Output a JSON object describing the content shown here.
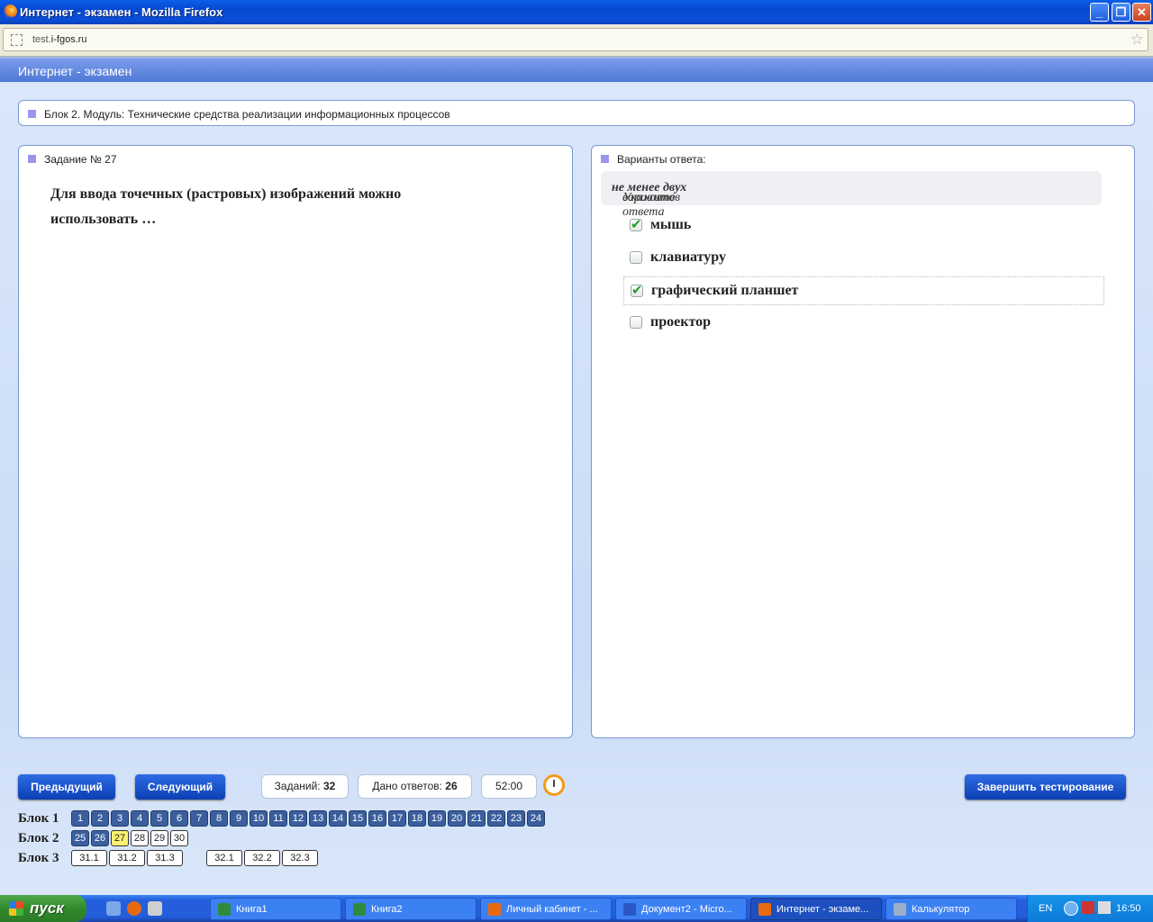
{
  "window": {
    "title": "Интернет - экзамен - Mozilla Firefox",
    "min": "_",
    "max": "❐",
    "close": "✕"
  },
  "address": {
    "url_prefix": "test.",
    "url_domain": "i-fgos.ru",
    "star": "☆"
  },
  "header": {
    "title": "Интернет - экзамен"
  },
  "block_info": {
    "text": "Блок 2. Модуль: Технические средства реализации информационных процессов"
  },
  "task": {
    "label": "Задание № 27",
    "question_line1": "Для ввода точечных (растровых) изображений можно",
    "question_line2": "использовать …"
  },
  "answers": {
    "label": "Варианты ответа:",
    "hint_pre": "Укажите ",
    "hint_bold": "не менее двух",
    "hint_post": " вариантов ответа",
    "options": [
      {
        "label": "мышь",
        "checked": true
      },
      {
        "label": "клавиатуру",
        "checked": false
      },
      {
        "label": "графический планшет",
        "checked": true
      },
      {
        "label": "проектор",
        "checked": false
      }
    ]
  },
  "nav": {
    "prev": "Предыдущий",
    "next": "Следующий",
    "tasks_label": "Заданий: ",
    "tasks_count": "32",
    "answered_label": "Дано ответов: ",
    "answered_count": "26",
    "timer": "52:00",
    "finish": "Завершить тестирование"
  },
  "blocks": [
    {
      "label": "Блок 1",
      "items": [
        {
          "n": "1",
          "s": "answered"
        },
        {
          "n": "2",
          "s": "answered"
        },
        {
          "n": "3",
          "s": "answered"
        },
        {
          "n": "4",
          "s": "answered"
        },
        {
          "n": "5",
          "s": "answered"
        },
        {
          "n": "6",
          "s": "answered"
        },
        {
          "n": "7",
          "s": "answered"
        },
        {
          "n": "8",
          "s": "answered"
        },
        {
          "n": "9",
          "s": "answered"
        },
        {
          "n": "10",
          "s": "answered"
        },
        {
          "n": "11",
          "s": "answered"
        },
        {
          "n": "12",
          "s": "answered"
        },
        {
          "n": "13",
          "s": "answered"
        },
        {
          "n": "14",
          "s": "answered"
        },
        {
          "n": "15",
          "s": "answered"
        },
        {
          "n": "16",
          "s": "answered"
        },
        {
          "n": "17",
          "s": "answered"
        },
        {
          "n": "18",
          "s": "answered"
        },
        {
          "n": "19",
          "s": "answered"
        },
        {
          "n": "20",
          "s": "answered"
        },
        {
          "n": "21",
          "s": "answered"
        },
        {
          "n": "22",
          "s": "answered"
        },
        {
          "n": "23",
          "s": "answered"
        },
        {
          "n": "24",
          "s": "answered"
        }
      ]
    },
    {
      "label": "Блок 2",
      "items": [
        {
          "n": "25",
          "s": "answered"
        },
        {
          "n": "26",
          "s": "answered"
        },
        {
          "n": "27",
          "s": "current"
        },
        {
          "n": "28",
          "s": "open"
        },
        {
          "n": "29",
          "s": "open"
        },
        {
          "n": "30",
          "s": "open"
        }
      ]
    },
    {
      "label": "Блок 3",
      "items": [
        {
          "n": "31.1",
          "s": "open"
        },
        {
          "n": "31.2",
          "s": "open"
        },
        {
          "n": "31.3",
          "s": "open"
        },
        {
          "n": "32.1",
          "s": "open"
        },
        {
          "n": "32.2",
          "s": "open"
        },
        {
          "n": "32.3",
          "s": "open"
        }
      ]
    }
  ],
  "taskbar": {
    "start": "пуск",
    "tasks": [
      {
        "label": "Книга1",
        "icon": "excel-icon"
      },
      {
        "label": "Книга2",
        "icon": "excel-icon"
      },
      {
        "label": "Личный кабинет - ...",
        "icon": "firefox-icon"
      },
      {
        "label": "Документ2 - Micro...",
        "icon": "word-icon"
      },
      {
        "label": "Интернет - экзаме...",
        "icon": "firefox-icon",
        "active": true
      },
      {
        "label": "Калькулятор",
        "icon": "calculator-icon"
      }
    ],
    "lang": "EN",
    "clock": "16:50"
  }
}
